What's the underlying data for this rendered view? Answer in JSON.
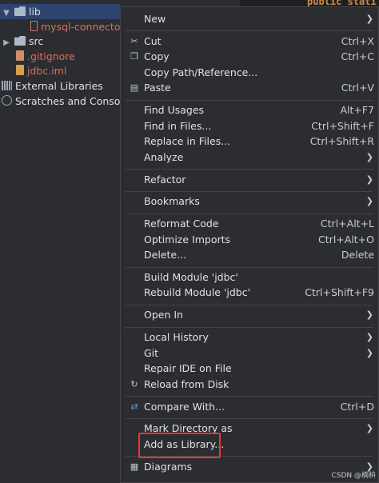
{
  "project_tree": {
    "items": [
      {
        "label": "lib"
      },
      {
        "label": "mysql-connector-j"
      },
      {
        "label": "src"
      },
      {
        "label": ".gitignore"
      },
      {
        "label": "jdbc.iml"
      },
      {
        "label": "External Libraries"
      },
      {
        "label": "Scratches and Consoles"
      }
    ]
  },
  "editor": {
    "text": "public stati"
  },
  "menu": {
    "items": [
      {
        "label": "New",
        "shortcut": "",
        "has_submenu": true
      },
      {
        "label": "Cut",
        "shortcut": "Ctrl+X",
        "icon": "cut-icon"
      },
      {
        "label": "Copy",
        "shortcut": "Ctrl+C",
        "icon": "copy-icon"
      },
      {
        "label": "Copy Path/Reference...",
        "shortcut": ""
      },
      {
        "label": "Paste",
        "shortcut": "Ctrl+V",
        "icon": "paste-icon"
      },
      {
        "label": "Find Usages",
        "shortcut": "Alt+F7"
      },
      {
        "label": "Find in Files...",
        "shortcut": "Ctrl+Shift+F"
      },
      {
        "label": "Replace in Files...",
        "shortcut": "Ctrl+Shift+R"
      },
      {
        "label": "Analyze",
        "shortcut": "",
        "has_submenu": true
      },
      {
        "label": "Refactor",
        "shortcut": "",
        "has_submenu": true
      },
      {
        "label": "Bookmarks",
        "shortcut": "",
        "has_submenu": true
      },
      {
        "label": "Reformat Code",
        "shortcut": "Ctrl+Alt+L"
      },
      {
        "label": "Optimize Imports",
        "shortcut": "Ctrl+Alt+O"
      },
      {
        "label": "Delete...",
        "shortcut": "Delete"
      },
      {
        "label": "Build Module 'jdbc'",
        "shortcut": ""
      },
      {
        "label": "Rebuild Module 'jdbc'",
        "shortcut": "Ctrl+Shift+F9"
      },
      {
        "label": "Open In",
        "shortcut": "",
        "has_submenu": true
      },
      {
        "label": "Local History",
        "shortcut": "",
        "has_submenu": true
      },
      {
        "label": "Git",
        "shortcut": "",
        "has_submenu": true
      },
      {
        "label": "Repair IDE on File",
        "shortcut": ""
      },
      {
        "label": "Reload from Disk",
        "shortcut": "",
        "icon": "reload-icon"
      },
      {
        "label": "Compare With...",
        "shortcut": "Ctrl+D",
        "icon": "compare-icon"
      },
      {
        "label": "Mark Directory as",
        "shortcut": "",
        "has_submenu": true
      },
      {
        "label": "Add as Library...",
        "shortcut": ""
      },
      {
        "label": "Diagrams",
        "shortcut": "",
        "has_submenu": true,
        "icon": "diagrams-icon"
      }
    ]
  },
  "colors": {
    "accent_highlight": "#e53935",
    "menu_bg": "#2b2d30",
    "selection": "#2e436e"
  },
  "watermark": "CSDN @楠枿"
}
